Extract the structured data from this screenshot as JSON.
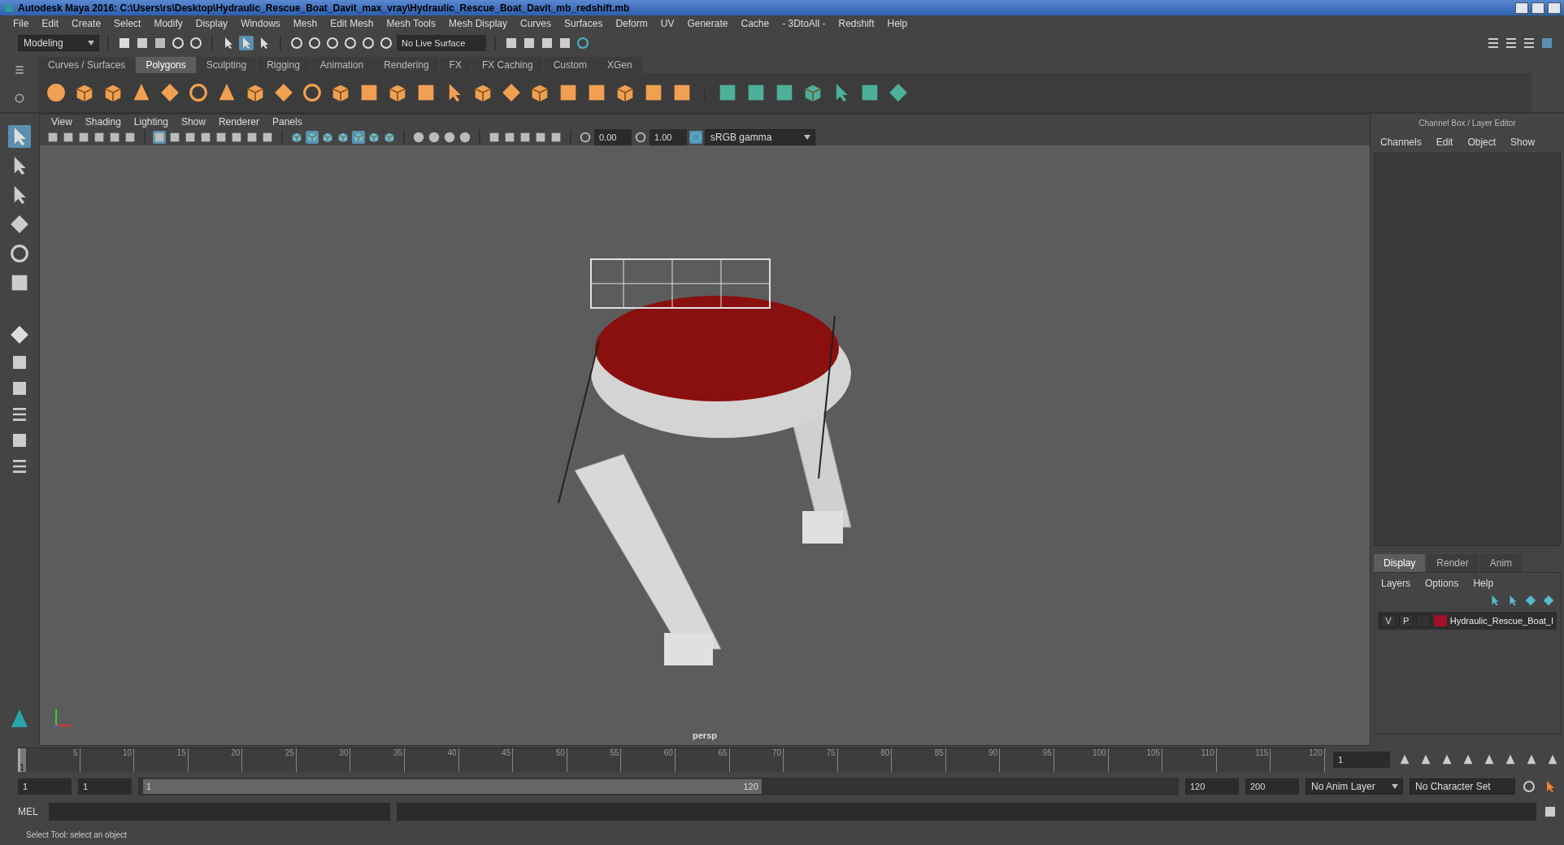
{
  "window": {
    "title": "Autodesk Maya 2016: C:\\Users\\rs\\Desktop\\Hydraulic_Rescue_Boat_Davit_max_vray\\Hydraulic_Rescue_Boat_Davit_mb_redshift.mb"
  },
  "menus": [
    "File",
    "Edit",
    "Create",
    "Select",
    "Modify",
    "Display",
    "Windows",
    "Mesh",
    "Edit Mesh",
    "Mesh Tools",
    "Mesh Display",
    "Curves",
    "Surfaces",
    "Deform",
    "UV",
    "Generate",
    "Cache",
    "- 3DtoAll -",
    "Redshift",
    "Help"
  ],
  "status_line": {
    "mode": "Modeling",
    "live_surface": "No Live Surface"
  },
  "shelf_tabs": [
    {
      "label": "Curves / Surfaces",
      "selected": false
    },
    {
      "label": "Polygons",
      "selected": true
    },
    {
      "label": "Sculpting",
      "selected": false
    },
    {
      "label": "Rigging",
      "selected": false
    },
    {
      "label": "Animation",
      "selected": false
    },
    {
      "label": "Rendering",
      "selected": false
    },
    {
      "label": "FX",
      "selected": false
    },
    {
      "label": "FX Caching",
      "selected": false
    },
    {
      "label": "Custom",
      "selected": false
    },
    {
      "label": "XGen",
      "selected": false
    }
  ],
  "viewport": {
    "menus": [
      "View",
      "Shading",
      "Lighting",
      "Show",
      "Renderer",
      "Panels"
    ],
    "exposure": "0.00",
    "gamma": "1.00",
    "color_space": "sRGB gamma",
    "camera": "persp"
  },
  "channel_box": {
    "title": "Channel Box / Layer Editor",
    "menus": [
      "Channels",
      "Edit",
      "Object",
      "Show"
    ]
  },
  "layer_editor": {
    "tabs": [
      {
        "label": "Display",
        "selected": true
      },
      {
        "label": "Render",
        "selected": false
      },
      {
        "label": "Anim",
        "selected": false
      }
    ],
    "menus": [
      "Layers",
      "Options",
      "Help"
    ],
    "layers": [
      {
        "visible": "V",
        "playback": "P",
        "color": "#a3102c",
        "name": "Hydraulic_Rescue_Boat_I"
      }
    ]
  },
  "timeline": {
    "start_label": "1",
    "ticks": [
      "5",
      "10",
      "15",
      "20",
      "25",
      "30",
      "35",
      "40",
      "45",
      "50",
      "55",
      "60",
      "65",
      "70",
      "75",
      "80",
      "85",
      "90",
      "95",
      "100",
      "105",
      "110",
      "115",
      "120"
    ],
    "current_frame": "1",
    "level": 0
  },
  "range": {
    "start": "1",
    "playback_start": "1",
    "slider_start": "1",
    "slider_end": "120",
    "level": 0.6,
    "playback_end": "120",
    "end": "200",
    "anim_layer": "No Anim Layer",
    "character_set": "No Character Set"
  },
  "command_line": {
    "label": "MEL"
  },
  "help_line": "Select Tool: select an object"
}
